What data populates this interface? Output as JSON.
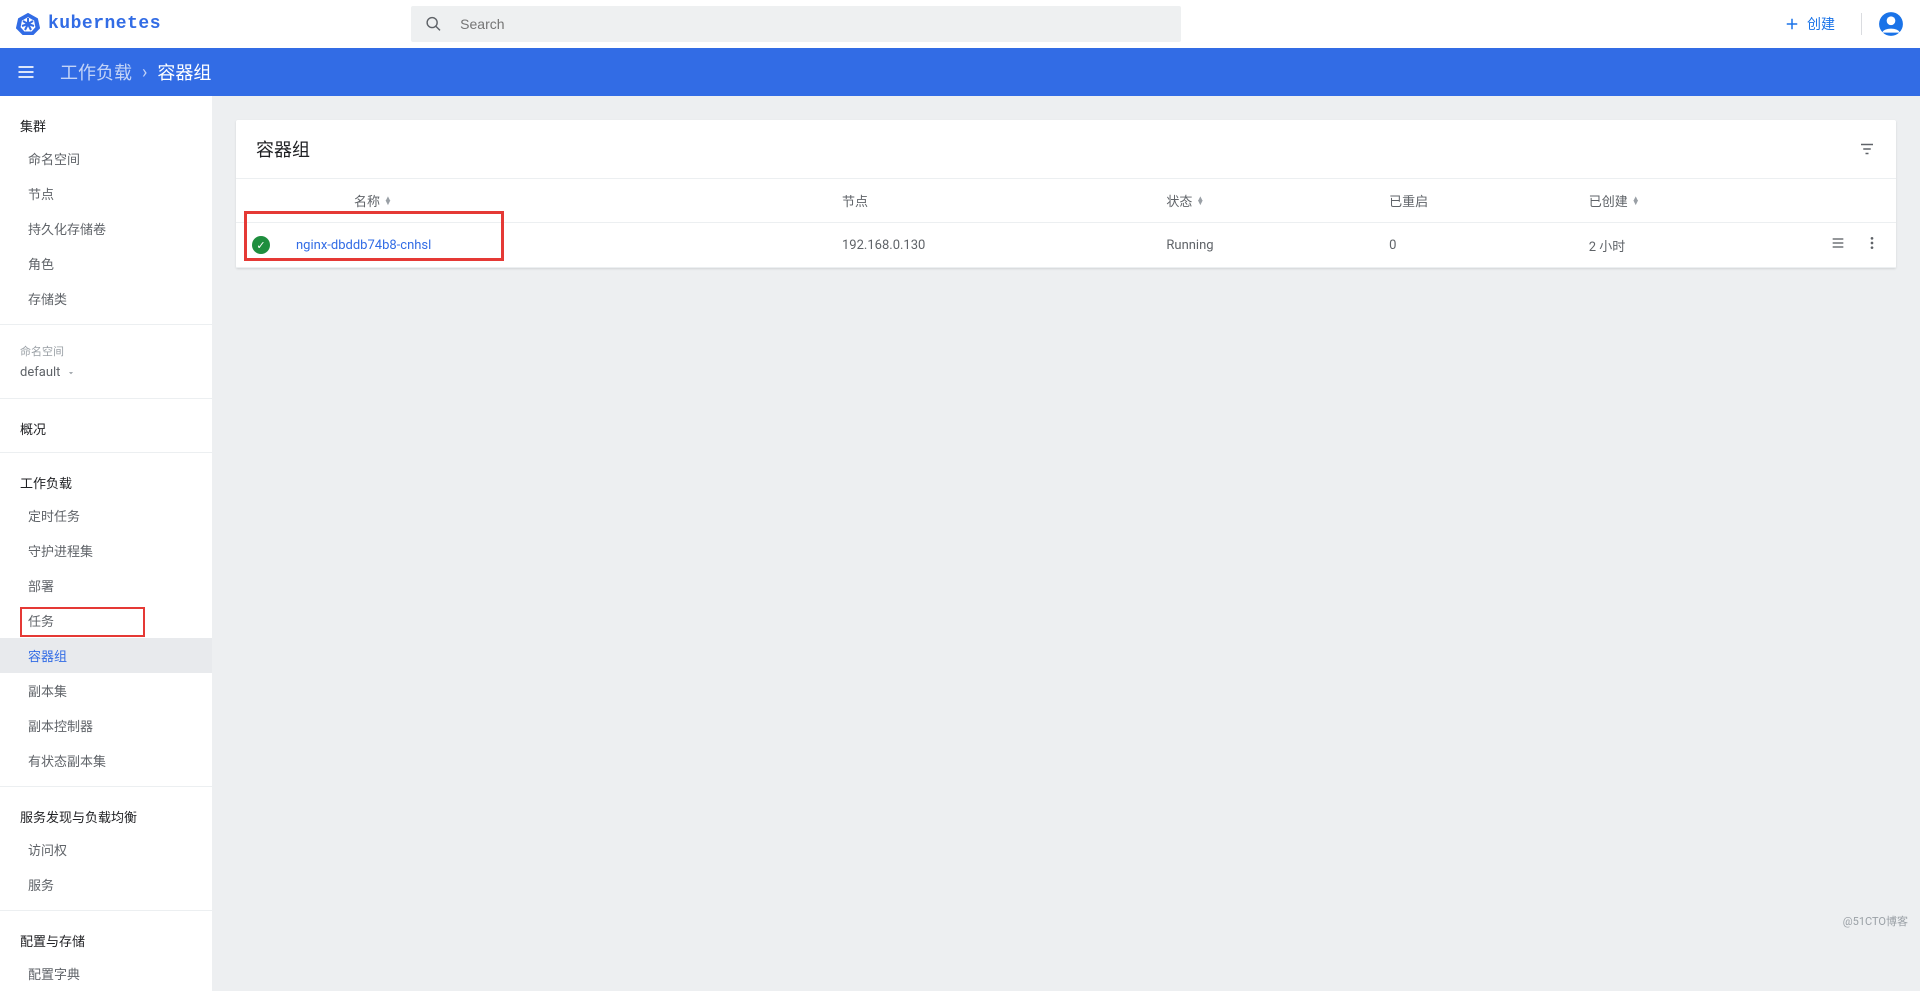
{
  "header": {
    "brand": "kubernetes",
    "search_placeholder": "Search",
    "create_label": "创建"
  },
  "breadcrumb": {
    "prev": "工作负载",
    "current": "容器组"
  },
  "sidebar": {
    "cluster": {
      "title": "集群",
      "items": [
        "命名空间",
        "节点",
        "持久化存储卷",
        "角色",
        "存储类"
      ]
    },
    "namespace": {
      "label": "命名空间",
      "selected": "default"
    },
    "overview": "概况",
    "workloads": {
      "title": "工作负载",
      "items": [
        "定时任务",
        "守护进程集",
        "部署",
        "任务",
        "容器组",
        "副本集",
        "副本控制器",
        "有状态副本集"
      ]
    },
    "discovery": {
      "title": "服务发现与负载均衡",
      "items": [
        "访问权",
        "服务"
      ]
    },
    "config": {
      "title": "配置与存储",
      "items": [
        "配置字典"
      ]
    },
    "active_item": "容器组"
  },
  "card": {
    "title": "容器组",
    "columns": {
      "name": "名称",
      "node": "节点",
      "status": "状态",
      "restarts": "已重启",
      "created": "已创建"
    },
    "rows": [
      {
        "name": "nginx-dbddb74b8-cnhsl",
        "node": "192.168.0.130",
        "status": "Running",
        "restarts": "0",
        "created": "2 小时"
      }
    ]
  },
  "watermark": "@51CTO博客"
}
